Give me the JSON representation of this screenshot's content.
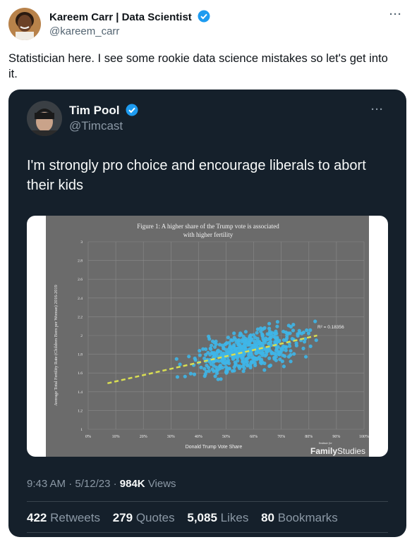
{
  "outer_tweet": {
    "author_name": "Kareem Carr | Data Scientist",
    "author_handle": "@kareem_carr",
    "text": "Statistician here. I see some rookie data science mistakes so let's get into it.",
    "more_label": "···"
  },
  "quoted_tweet": {
    "author_name": "Tim Pool",
    "author_handle": "@Timcast",
    "text": "I'm strongly pro choice and encourage liberals to abort their kids",
    "more_label": "···",
    "time": "9:43 AM",
    "date": "5/12/23",
    "separator": "·",
    "views_count": "984K",
    "views_label": "Views",
    "stats": [
      {
        "count": "422",
        "label": "Retweets"
      },
      {
        "count": "279",
        "label": "Quotes"
      },
      {
        "count": "5,085",
        "label": "Likes"
      },
      {
        "count": "80",
        "label": "Bookmarks"
      }
    ]
  },
  "colors": {
    "verified": "#1d9bf0",
    "card_bg": "#15202b",
    "chart_bg": "#6b6b6b",
    "dots": "#3fb6e8",
    "trend": "#d9de52"
  },
  "chart_data": {
    "type": "scatter",
    "title": "Figure 1: A higher share of the Trump vote is associated with higher fertility",
    "title_lines": [
      "Figure 1: A higher share of the Trump vote is associated",
      "with higher fertility"
    ],
    "xlabel": "Donald Trump Vote Share",
    "ylabel": "Average Total Fertility Rate (Children Born per Woman) 2016-2019",
    "x_ticks": [
      "0%",
      "10%",
      "20%",
      "30%",
      "40%",
      "50%",
      "60%",
      "70%",
      "80%",
      "90%",
      "100%"
    ],
    "y_ticks": [
      "1",
      "1.2",
      "1.4",
      "1.6",
      "1.8",
      "2",
      "2.2",
      "2.4",
      "2.6",
      "2.8",
      "3"
    ],
    "xlim": [
      0,
      1
    ],
    "ylim": [
      1,
      3
    ],
    "annotation": "R² = 0.18356",
    "trendline": {
      "x": [
        0.07,
        0.83
      ],
      "y": [
        1.49,
        2.0
      ]
    },
    "logo_small": "Institute for",
    "logo_big": "Family",
    "logo_light": "Studies",
    "grid": true,
    "approx_point_count": 480
  }
}
